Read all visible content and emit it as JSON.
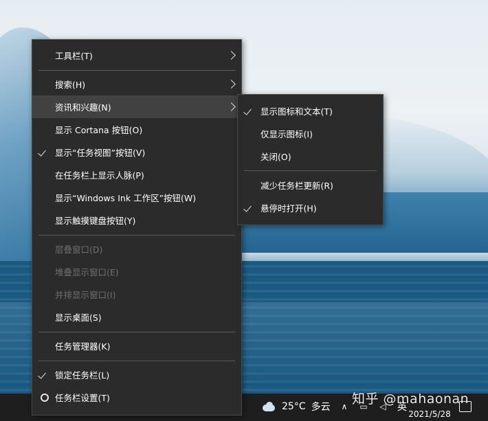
{
  "main_menu": {
    "items": [
      {
        "label": "工具栏(T)",
        "submenu": true
      },
      {
        "label": "搜索(H)",
        "submenu": true
      },
      {
        "label": "资讯和兴趣(N)",
        "submenu": true,
        "hover": true
      },
      {
        "label": "显示 Cortana 按钮(O)"
      },
      {
        "label": "显示“任务视图”按钮(V)",
        "checked": true
      },
      {
        "label": "在任务栏上显示人脉(P)"
      },
      {
        "label": "显示“Windows Ink 工作区”按钮(W)"
      },
      {
        "label": "显示触摸键盘按钮(Y)"
      },
      {
        "label": "层叠窗口(D)",
        "disabled": true
      },
      {
        "label": "堆叠显示窗口(E)",
        "disabled": true
      },
      {
        "label": "并排显示窗口(I)",
        "disabled": true
      },
      {
        "label": "显示桌面(S)"
      },
      {
        "label": "任务管理器(K)"
      },
      {
        "label": "锁定任务栏(L)",
        "checked": true
      },
      {
        "label": "任务栏设置(T)",
        "icon": "gear-icon"
      }
    ]
  },
  "sub_menu": {
    "items": [
      {
        "label": "显示图标和文本(T)",
        "checked": true
      },
      {
        "label": "仅显示图标(I)"
      },
      {
        "label": "关闭(O)"
      },
      {
        "label": "减少任务栏更新(R)"
      },
      {
        "label": "悬停时打开(H)",
        "checked": true
      }
    ]
  },
  "taskbar": {
    "weather_temp": "25°C",
    "weather_desc": "多云",
    "ime_label": "英",
    "date": "2021/5/28",
    "icons": [
      "cloud-icon",
      "chevron-up-icon",
      "network-icon",
      "volume-icon",
      "notification-icon"
    ]
  },
  "watermark": "知乎 @mahaonan",
  "colors": {
    "menu_bg": "#2b2b2b",
    "menu_hover": "#414141",
    "menu_text": "#ffffff",
    "menu_disabled": "#6f6f6f",
    "taskbar_bg": "#1e1e1e"
  }
}
